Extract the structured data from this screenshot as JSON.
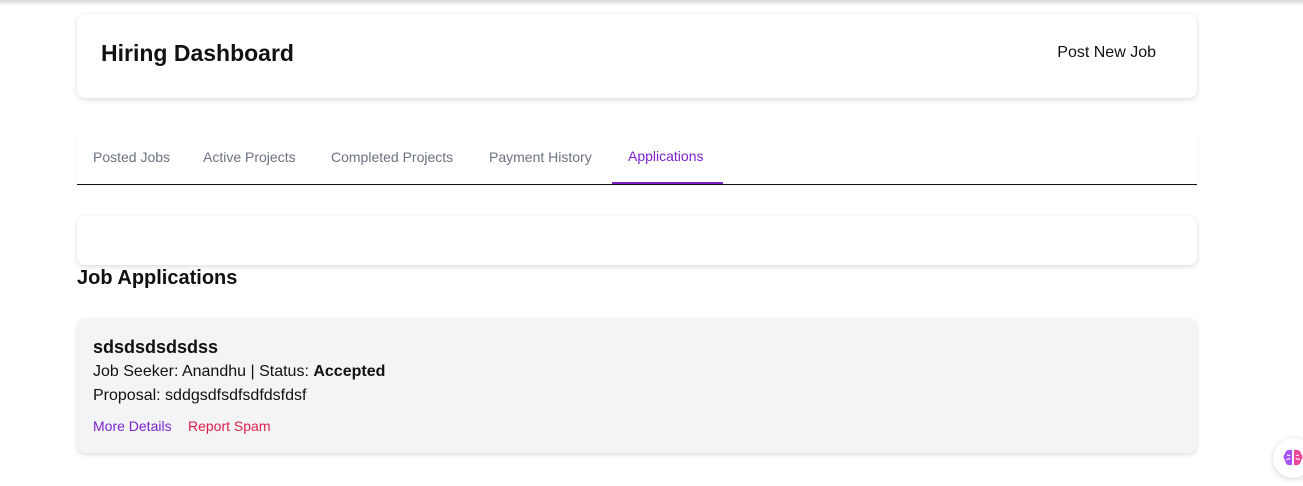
{
  "header": {
    "title": "Hiring Dashboard",
    "post_job_label": "Post New Job"
  },
  "tabs": [
    {
      "label": "Posted Jobs",
      "active": false
    },
    {
      "label": "Active Projects",
      "active": false
    },
    {
      "label": "Completed Projects",
      "active": false
    },
    {
      "label": "Payment History",
      "active": false
    },
    {
      "label": "Applications",
      "active": true
    }
  ],
  "section": {
    "title": "Job Applications"
  },
  "applications": [
    {
      "job_title": "sdsdsdsdsdss",
      "seeker_label": "Job Seeker:",
      "seeker_name": "Anandhu",
      "status_label": "Status:",
      "status": "Accepted",
      "proposal_label": "Proposal:",
      "proposal": "sddgsdfsdfsdfdsfdsf",
      "more_details_label": "More Details",
      "report_spam_label": "Report Spam"
    }
  ],
  "colors": {
    "accent": "#7e22ce",
    "danger": "#e11d48",
    "card_bg": "#f3f4f6"
  },
  "floating_button": {
    "icon": "brain-icon"
  }
}
